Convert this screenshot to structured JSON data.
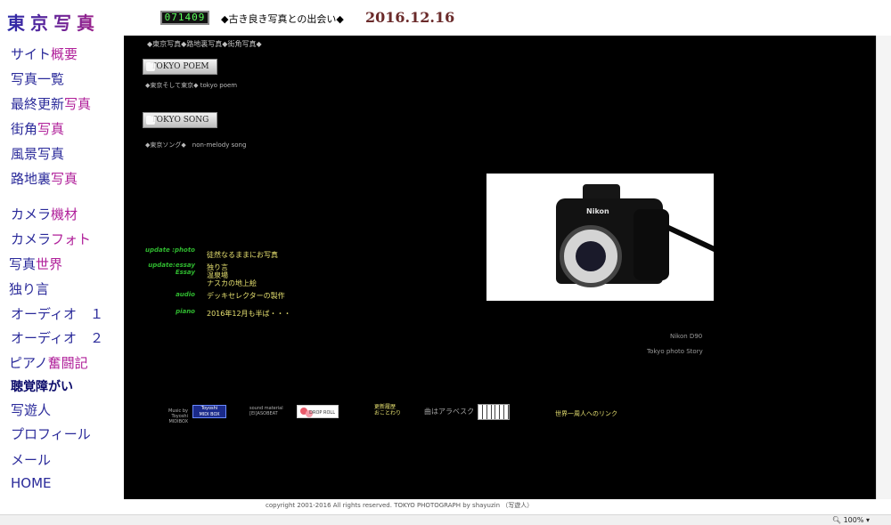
{
  "header": {
    "site_title": "東京写真",
    "counter": "071409",
    "tagline": "◆古き良き写真との出会い◆",
    "date": "2016.12.16"
  },
  "sidebar": {
    "items": [
      {
        "label": "サイト",
        "accent": "概要"
      },
      {
        "label": "写真一覧",
        "accent": ""
      },
      {
        "label": "最終更新",
        "accent": "写真"
      },
      {
        "label": "街角",
        "accent": "写真"
      },
      {
        "label": "風景写真",
        "accent": ""
      },
      {
        "label": "路地裏",
        "accent": "写真"
      },
      {
        "label": "カメラ",
        "accent": "機材"
      },
      {
        "label": "カメラ",
        "accent": "フォト"
      },
      {
        "label": "写真",
        "accent": "世界"
      },
      {
        "label": "独り言",
        "accent": ""
      },
      {
        "label": "オーディオ　１",
        "accent": ""
      },
      {
        "label": "オーディオ　２",
        "accent": ""
      },
      {
        "label": "ピアノ",
        "accent": "奮闘記"
      },
      {
        "label": "聴覚障がい",
        "accent": ""
      },
      {
        "label": "写遊人",
        "accent": ""
      },
      {
        "label": "プロフィール",
        "accent": ""
      },
      {
        "label": "メール",
        "accent": ""
      },
      {
        "label": "HOME",
        "accent": ""
      }
    ]
  },
  "main": {
    "breadcrumb": "◆東京写真◆路地裏写真◆街角写真◆",
    "poem_button": "TOKYO POEM",
    "poem_sub": "◆東京そして東京◆ tokyo poem",
    "song_button": "TOKYO SONG",
    "song_sub": "◆東京ソング◆　non-melody song",
    "photo_brand": "Nikon",
    "photo_caption": "Nikon  D90",
    "photo_story": "Tokyo photo  Story",
    "updates": [
      {
        "label": "update :photo",
        "text": "徒然なるままにお写真"
      },
      {
        "label": "update:essay\nEssay",
        "text": "独り言\n温泉場\nナスカの地上絵"
      },
      {
        "label": "audio",
        "text": "デッキセレクターの製作"
      },
      {
        "label": "piano",
        "text": "2016年12月も半ば・・・"
      }
    ],
    "credits": {
      "midi_by": "Music by Toyoshi\nMIDIBOX",
      "midi_badge": "Toyoshi\nMIDI BOX",
      "sound_material": "sound material\n[EI]ASOBEAT",
      "drop_roll": "DROP ROLL",
      "history": "更新履歴\nおことわり",
      "aria": "曲はアラベスク",
      "world_link": "世界一周人へのリンク"
    }
  },
  "footer": {
    "copyright": "copyright 2001-2016  All rights reserved. TOKYO PHOTOGRAPH by shayuzin  （写遊人）",
    "zoom": "100%"
  }
}
